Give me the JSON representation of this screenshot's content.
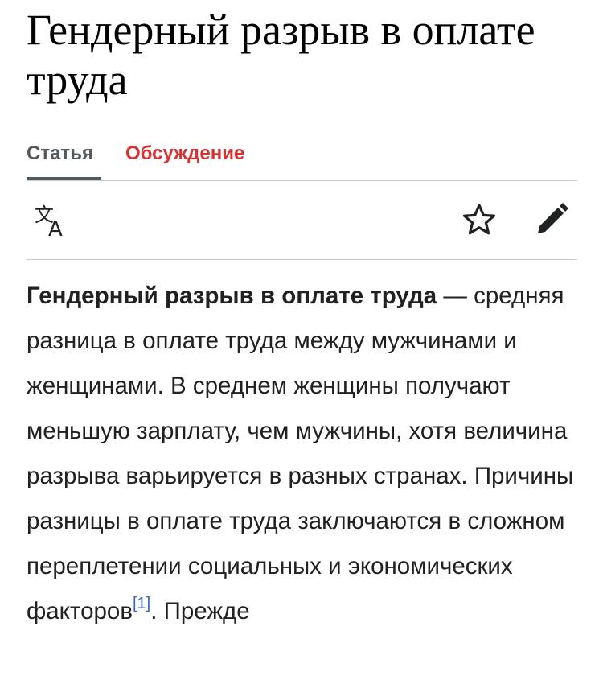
{
  "article": {
    "title": "Гендерный разрыв в оплате труда"
  },
  "tabs": {
    "article_label": "Статья",
    "talk_label": "Обсуждение"
  },
  "icons": {
    "language": "language-icon",
    "watch": "star-icon",
    "edit": "pencil-icon"
  },
  "colors": {
    "text": "#202122",
    "tab_active": "#54595d",
    "tab_talk": "#d73333",
    "link": "#3366cc",
    "divider": "#c8ccd1"
  },
  "body": {
    "lead_bold": "Гендерный разрыв в оплате труда",
    "lead_text": " — средняя разница в оплате труда между мужчинами и женщинами. В среднем женщины получают меньшую зарплату, чем мужчины, хотя величина разрыва варьируется в разных странах. Причины разницы в оплате труда заключаются в сложном переплетении социальных и экономических факторов",
    "ref_label": "[1]",
    "after_ref": ". Прежде"
  }
}
